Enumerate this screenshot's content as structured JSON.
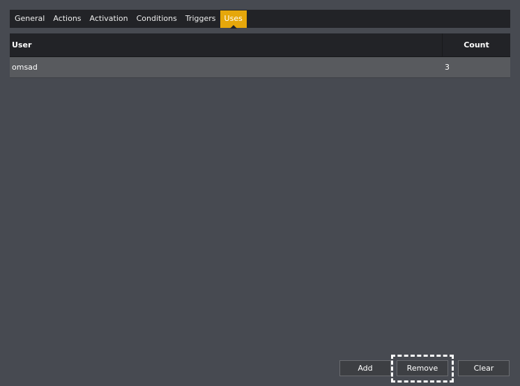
{
  "tabs": [
    {
      "label": "General"
    },
    {
      "label": "Actions"
    },
    {
      "label": "Activation"
    },
    {
      "label": "Conditions"
    },
    {
      "label": "Triggers"
    },
    {
      "label": "Uses",
      "active": true
    }
  ],
  "table": {
    "headers": {
      "user": "User",
      "count": "Count"
    },
    "rows": [
      {
        "user": "omsad",
        "count": "3"
      }
    ]
  },
  "buttons": {
    "add": "Add",
    "remove": "Remove",
    "clear": "Clear"
  },
  "colors": {
    "background": "#474a51",
    "header_bg": "#222327",
    "accent": "#e6a70b",
    "row_bg": "#585a5e"
  }
}
